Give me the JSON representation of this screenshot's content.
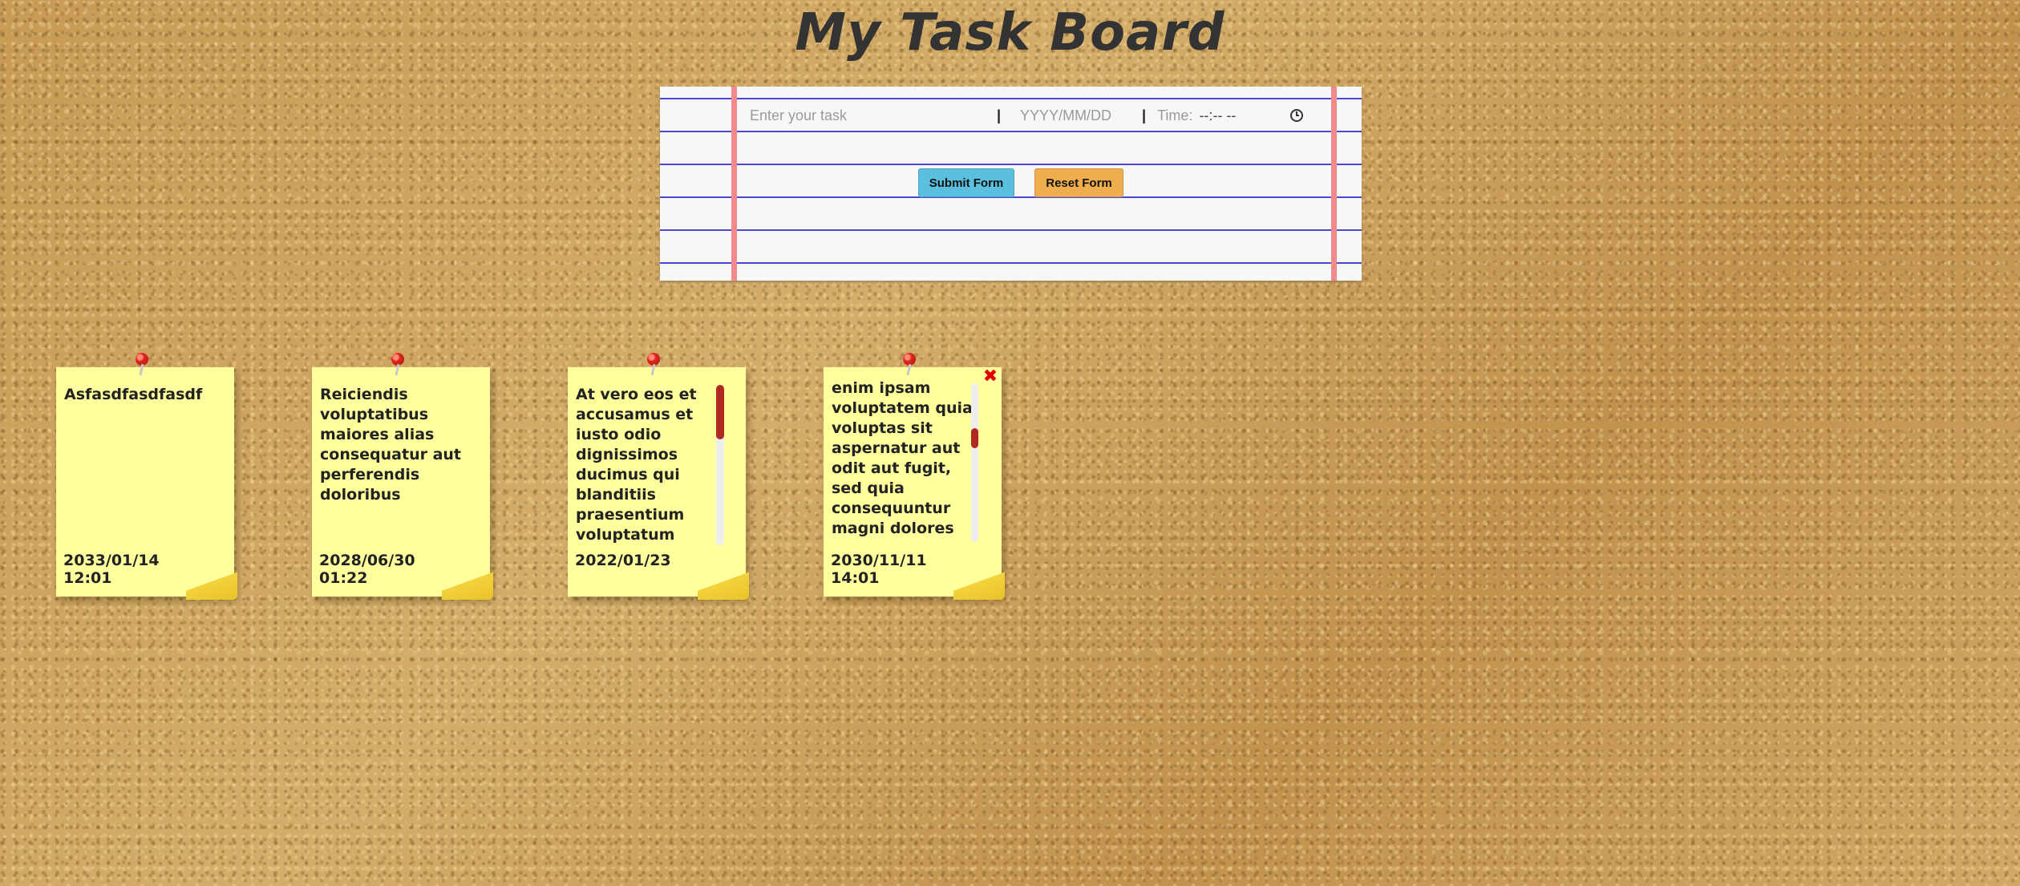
{
  "header": {
    "title": "My Task Board"
  },
  "form": {
    "task_placeholder": "Enter your task",
    "separator": "|",
    "date_placeholder": "YYYY/MM/DD",
    "time_label": "Time:",
    "time_value": "--:-- --",
    "submit_label": "Submit Form",
    "reset_label": "Reset Form"
  },
  "notes": [
    {
      "text": "Asfasdfasdfasdf",
      "date": "2033/01/14",
      "time": "12:01",
      "scrollbar": false
    },
    {
      "text": "Reiciendis voluptatibus maiores alias consequatur aut perferendis doloribus",
      "date": "2028/06/30",
      "time": "01:22",
      "scrollbar": false
    },
    {
      "text": "At vero eos et accusamus et iusto odio dignissimos ducimus qui blanditiis praesentium voluptatum",
      "date": "2022/01/23",
      "time": "",
      "scrollbar": true
    },
    {
      "text": "enim ipsam voluptatem quia voluptas sit aspernatur aut odit aut fugit, sed quia consequuntur magni dolores",
      "date": "2030/11/11",
      "time": "14:01",
      "scrollbar": true,
      "close_symbol": "✖"
    }
  ],
  "colors": {
    "note_bg": "#ffff9d",
    "submit_bg": "#5bc0de",
    "reset_bg": "#f0ad4e",
    "paper_line": "#4a46d6",
    "paper_margin": "#f08a8c",
    "pin": "#e0281c",
    "close": "#e00000"
  },
  "icons": {
    "pin": "pushpin-icon",
    "time": "clock-icon",
    "close": "close-icon"
  }
}
